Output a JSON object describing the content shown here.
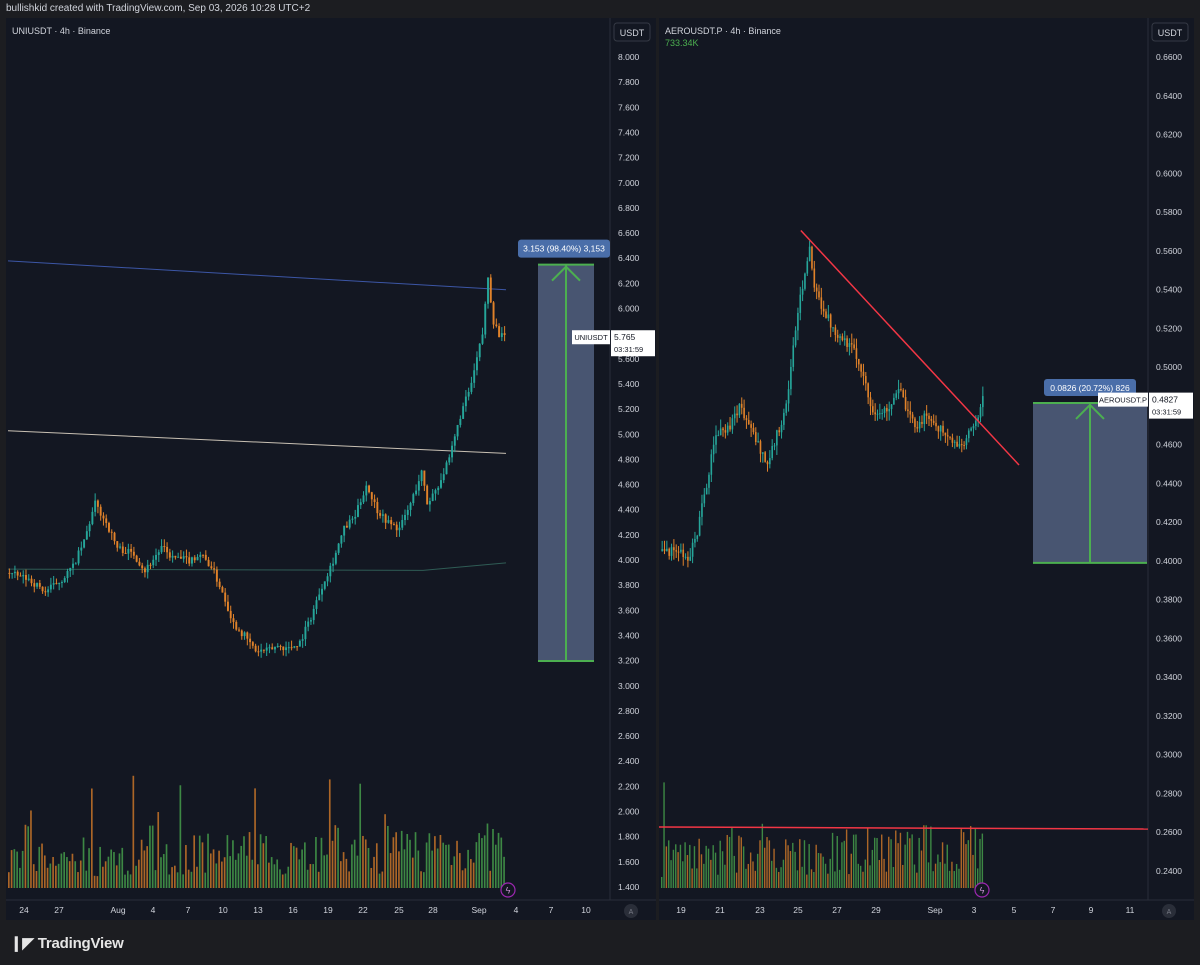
{
  "header": {
    "caption": "bullishkid created with TradingView.com, Sep 03, 2026 10:28 UTC+2"
  },
  "footer": {
    "brand": "TradingView"
  },
  "colors": {
    "bull": "#26a69a",
    "bear": "#ef5350",
    "measure_fill": "#5b6b8c",
    "measure_line": "#4caf50",
    "label_bg": "#4a6ea9",
    "trendline": "#f23645",
    "ma_blue": "#3c56a6",
    "ma_gray": "#c9c1b4",
    "ma_teal": "#2f5c55"
  },
  "chart_data": [
    {
      "type": "candlestick",
      "title": "UNIUSDT · 4h · Binance",
      "currency": "USDT",
      "ylim": [
        3.2,
        8.0
      ],
      "y_ticks": [
        "8.000",
        "7.800",
        "7.600",
        "7.400",
        "7.200",
        "7.000",
        "6.800",
        "6.600",
        "6.400",
        "6.200",
        "6.000",
        "5.800",
        "5.600",
        "5.400",
        "5.200",
        "5.000",
        "4.800",
        "4.600",
        "4.400",
        "4.200",
        "4.000",
        "3.800",
        "3.600",
        "3.400",
        "3.200",
        "3.000",
        "2.800",
        "2.600",
        "2.400",
        "2.200",
        "2.000",
        "1.800",
        "1.600",
        "1.400"
      ],
      "x_ticks": [
        "24",
        "27",
        "Aug",
        "4",
        "7",
        "10",
        "13",
        "16",
        "19",
        "22",
        "25",
        "28",
        "Sep",
        "4",
        "7",
        "10"
      ],
      "price_path": [
        [
          0,
          3.9
        ],
        [
          8,
          3.85
        ],
        [
          14,
          3.75
        ],
        [
          20,
          3.85
        ],
        [
          24,
          3.95
        ],
        [
          28,
          4.15
        ],
        [
          32,
          4.45
        ],
        [
          36,
          4.3
        ],
        [
          40,
          4.1
        ],
        [
          46,
          4.05
        ],
        [
          50,
          3.92
        ],
        [
          56,
          4.1
        ],
        [
          60,
          4.02
        ],
        [
          66,
          4.0
        ],
        [
          70,
          4.05
        ],
        [
          74,
          3.95
        ],
        [
          78,
          3.75
        ],
        [
          82,
          3.5
        ],
        [
          86,
          3.4
        ],
        [
          90,
          3.28
        ],
        [
          94,
          3.28
        ],
        [
          98,
          3.32
        ],
        [
          102,
          3.3
        ],
        [
          106,
          3.35
        ],
        [
          110,
          3.55
        ],
        [
          114,
          3.8
        ],
        [
          118,
          4.0
        ],
        [
          122,
          4.25
        ],
        [
          126,
          4.35
        ],
        [
          130,
          4.6
        ],
        [
          134,
          4.4
        ],
        [
          138,
          4.3
        ],
        [
          142,
          4.25
        ],
        [
          146,
          4.45
        ],
        [
          150,
          4.7
        ],
        [
          152,
          4.45
        ],
        [
          156,
          4.6
        ],
        [
          160,
          4.8
        ],
        [
          164,
          5.15
        ],
        [
          168,
          5.4
        ],
        [
          172,
          5.8
        ],
        [
          174,
          6.25
        ],
        [
          176,
          5.9
        ],
        [
          178,
          5.8
        ],
        [
          180,
          5.765
        ]
      ],
      "n_bars": 180,
      "moving_averages": [
        {
          "color": "ma_blue",
          "points": [
            [
              0,
              6.38
            ],
            [
              180,
              6.15
            ]
          ]
        },
        {
          "color": "ma_gray",
          "points": [
            [
              0,
              5.03
            ],
            [
              180,
              4.85
            ]
          ]
        },
        {
          "color": "ma_teal",
          "points": [
            [
              0,
              3.93
            ],
            [
              150,
              3.92
            ],
            [
              180,
              3.98
            ]
          ]
        }
      ],
      "measure": {
        "label": "3.153 (98.40%) 3,153",
        "from": 3.2,
        "to": 6.35
      },
      "price_label": {
        "symbol": "UNIUSDT",
        "price": "5.765",
        "countdown": "03:31:59",
        "value": 5.765
      }
    },
    {
      "type": "candlestick",
      "title": "AEROUSDT.P · 4h · Binance",
      "volume_label": "733.34K",
      "currency": "USDT",
      "ylim": [
        0.24,
        0.66
      ],
      "y_ticks": [
        "0.6600",
        "0.6400",
        "0.6200",
        "0.6000",
        "0.5800",
        "0.5600",
        "0.5400",
        "0.5200",
        "0.5000",
        "0.4800",
        "0.4600",
        "0.4400",
        "0.4200",
        "0.4000",
        "0.3800",
        "0.3600",
        "0.3400",
        "0.3200",
        "0.3000",
        "0.2800",
        "0.2600",
        "0.2400"
      ],
      "x_ticks": [
        "19",
        "21",
        "23",
        "25",
        "27",
        "29",
        "Sep",
        "3",
        "5",
        "7",
        "9",
        "11"
      ],
      "price_path": [
        [
          0,
          0.405
        ],
        [
          8,
          0.405
        ],
        [
          12,
          0.4
        ],
        [
          16,
          0.415
        ],
        [
          20,
          0.44
        ],
        [
          24,
          0.465
        ],
        [
          30,
          0.47
        ],
        [
          34,
          0.48
        ],
        [
          38,
          0.47
        ],
        [
          42,
          0.46
        ],
        [
          46,
          0.45
        ],
        [
          50,
          0.465
        ],
        [
          54,
          0.48
        ],
        [
          58,
          0.52
        ],
        [
          62,
          0.55
        ],
        [
          64,
          0.56
        ],
        [
          66,
          0.54
        ],
        [
          70,
          0.53
        ],
        [
          74,
          0.52
        ],
        [
          78,
          0.515
        ],
        [
          82,
          0.51
        ],
        [
          86,
          0.5
        ],
        [
          90,
          0.48
        ],
        [
          94,
          0.475
        ],
        [
          98,
          0.48
        ],
        [
          102,
          0.49
        ],
        [
          106,
          0.475
        ],
        [
          110,
          0.47
        ],
        [
          114,
          0.475
        ],
        [
          118,
          0.47
        ],
        [
          122,
          0.465
        ],
        [
          126,
          0.46
        ],
        [
          130,
          0.46
        ],
        [
          134,
          0.47
        ],
        [
          138,
          0.483
        ]
      ],
      "n_bars": 138,
      "trendline": {
        "from": [
          0.565,
          0.5705
        ],
        "to": [
          0.925,
          0.4495
        ]
      },
      "volume_line_level": 0.93,
      "measure": {
        "label": "0.0826 (20.72%) 826",
        "from": 0.399,
        "to": 0.4815
      },
      "price_label": {
        "symbol": "AEROUSDT.P",
        "price": "0.4827",
        "countdown": "03:31:59",
        "value": 0.4827
      }
    }
  ]
}
